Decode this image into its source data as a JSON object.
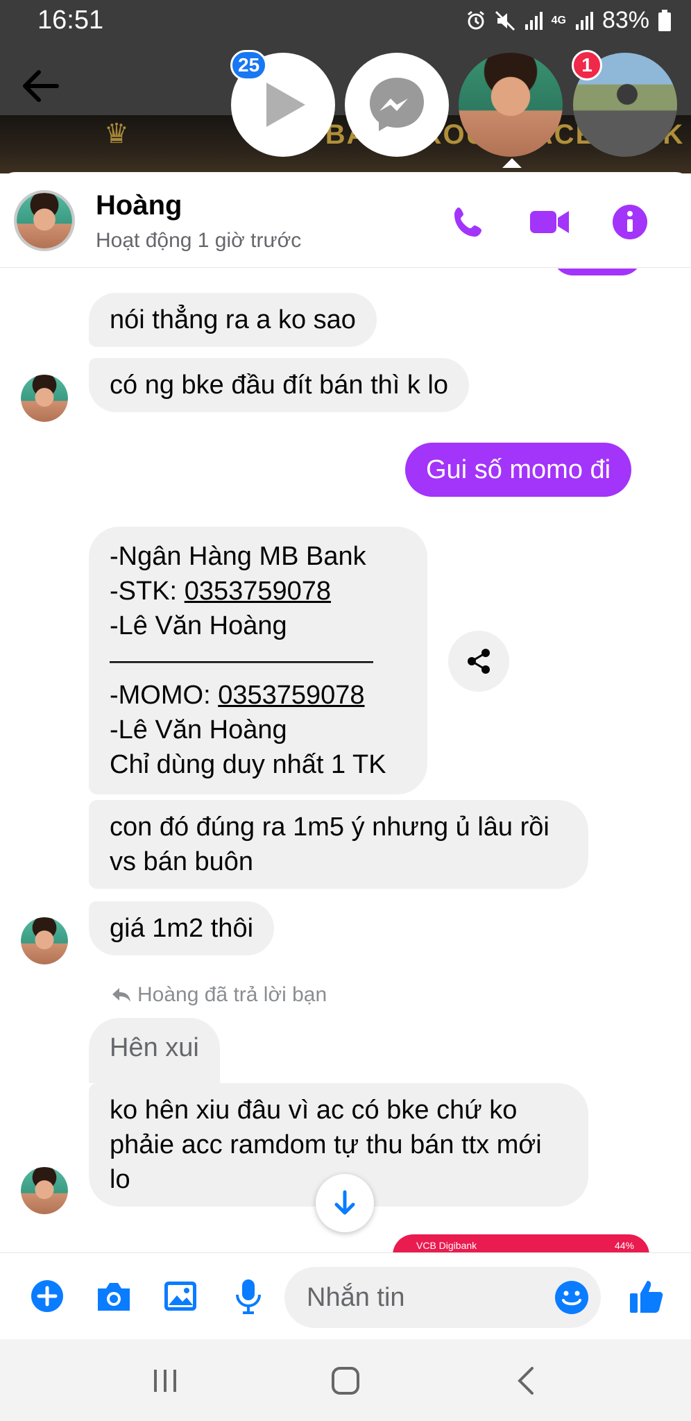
{
  "status_bar": {
    "time": "16:51",
    "network": "4G",
    "battery": "83%"
  },
  "chat_heads": [
    {
      "name": "video-head",
      "badge": "25"
    },
    {
      "name": "messenger-head"
    },
    {
      "name": "user-head"
    },
    {
      "name": "user2-head",
      "badge": "1"
    }
  ],
  "background_banner": {
    "text": "MUA BÁN GROUP FACEBOOK"
  },
  "header": {
    "name": "Hoàng",
    "status": "Hoạt động 1 giờ trước"
  },
  "messages": [
    {
      "from": "them",
      "text": "nói thẳng ra a ko sao"
    },
    {
      "from": "them",
      "text": "có ng bke đầu đít bán thì k lo"
    },
    {
      "from": "me",
      "text": "Gui số momo đi"
    },
    {
      "from": "them",
      "lines": [
        "-Ngân Hàng MB Bank",
        "-STK: ",
        "0353759078",
        "-Lê Văn Hoàng",
        "——————————",
        "-MOMO: ",
        "0353759078",
        "-Lê Văn Hoàng",
        "Chỉ dùng duy nhất 1 TK"
      ]
    },
    {
      "from": "them",
      "text": "con đó đúng ra 1m5 ý nhưng ủ lâu rồi vs bán buôn"
    },
    {
      "from": "them",
      "text": "giá 1m2 thôi"
    },
    {
      "from": "them",
      "reply_label": "Hoàng đã trả lời bạn",
      "quoted": "Hên xui",
      "text": "ko hên xiu đâu vì ac có bke chứ ko phảie acc ramdom tự thu bán ttx mới lo"
    }
  ],
  "image_preview": {
    "label": "VCB Digibank",
    "right_text": "44%"
  },
  "composer": {
    "placeholder": "Nhắn tin"
  },
  "colors": {
    "accent": "#a334fa",
    "bubble_in": "#f0f0f0",
    "messenger_blue": "#0a7cff",
    "badge_red": "#f02849",
    "badge_blue": "#1877f2"
  }
}
